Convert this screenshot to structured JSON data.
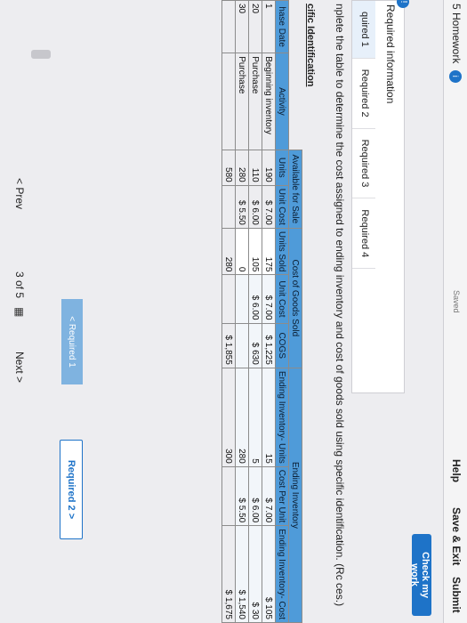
{
  "header": {
    "title": "5 Homework",
    "badge": "i",
    "saved": "Saved",
    "help": "Help",
    "save_exit": "Save & Exit",
    "submit": "Submit"
  },
  "check_button": "Check my work",
  "info": {
    "label": "Required information",
    "tabs": [
      "quired 1",
      "Required 2",
      "Required 3",
      "Required 4"
    ]
  },
  "instruction": "nplete the table to determine the cost assigned to ending inventory and cost of goods sold using specific identification. (Rc ces.)",
  "section_title": "cific Identification",
  "table": {
    "group_headers": [
      "Available for Sale",
      "Cost of Goods Sold",
      "Ending Inventory"
    ],
    "col_headers": [
      "hase Date",
      "Activity",
      "Units",
      "Unit Cost",
      "Units Sold",
      "Unit Cost",
      "COGS",
      "Ending Inventory- Units",
      "Cost Per Unit",
      "Ending Inventory- Cost"
    ],
    "rows": [
      {
        "date": "1",
        "activity": "Beginning inventory",
        "units": "190",
        "unit_cost": "$ 7.00",
        "units_sold": "175",
        "sold_cost": "$ 7.00",
        "cogs": "$ 1,225",
        "end_units": "15",
        "end_cpu": "$ 7.00",
        "end_cost": "$ 105"
      },
      {
        "date": "20",
        "activity": "Purchase",
        "units": "110",
        "unit_cost": "$ 6.00",
        "units_sold": "105",
        "sold_cost": "$ 6.00",
        "cogs": "$ 630",
        "end_units": "5",
        "end_cpu": "$ 6.00",
        "end_cost": "$ 30"
      },
      {
        "date": "30",
        "activity": "Purchase",
        "units": "280",
        "unit_cost": "$ 5.50",
        "units_sold": "0",
        "sold_cost": "",
        "cogs": "",
        "end_units": "280",
        "end_cpu": "$ 5.50",
        "end_cost": "$ 1,540"
      }
    ],
    "totals": {
      "units": "580",
      "units_sold": "280",
      "cogs": "$ 1,855",
      "end_units": "300",
      "end_cost": "$ 1,675"
    }
  },
  "required_prev": "< Required 1",
  "required_next": "Required 2 >",
  "pager": {
    "prev": "< Prev",
    "page": "3 of 5",
    "grid": "▦",
    "next": "Next >"
  },
  "colors": {
    "accent": "#1e73c8",
    "header_fill": "#4f9bd9"
  }
}
